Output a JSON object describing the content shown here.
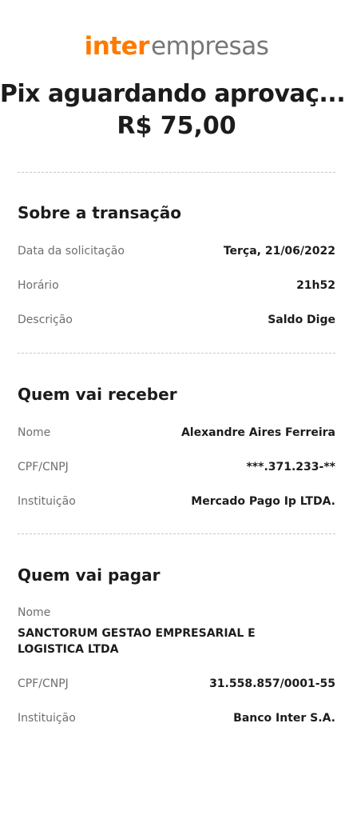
{
  "header": {
    "brand": "inter",
    "brand_suffix": "empresas"
  },
  "transfer": {
    "status_title": "Pix aguardando aprovaç...",
    "amount": "R$ 75,00"
  },
  "transaction": {
    "section_title": "Sobre a transação",
    "date_label": "Data da solicitação",
    "date_value": "Terça, 21/06/2022",
    "time_label": "Horário",
    "time_value": "21h52",
    "description_label": "Descrição",
    "description_value": "Saldo Dige"
  },
  "receiver": {
    "section_title": "Quem vai receber",
    "name_label": "Nome",
    "name_value": "Alexandre Aires Ferreira",
    "doc_label": "CPF/CNPJ",
    "doc_value": "***.371.233-**",
    "institution_label": "Instituição",
    "institution_value": "Mercado Pago Ip LTDA."
  },
  "payer": {
    "section_title": "Quem vai pagar",
    "name_label": "Nome",
    "name_value": "SANCTORUM GESTAO EMPRESARIAL E LOGISTICA LTDA",
    "doc_label": "CPF/CNPJ",
    "doc_value": "31.558.857/0001-55",
    "institution_label": "Instituição",
    "institution_value": "Banco Inter S.A."
  },
  "colors": {
    "brand_orange": "#ff7a00",
    "text_primary": "#1c1c1e",
    "text_secondary": "#6e6e73",
    "divider": "#c8c8cc"
  }
}
